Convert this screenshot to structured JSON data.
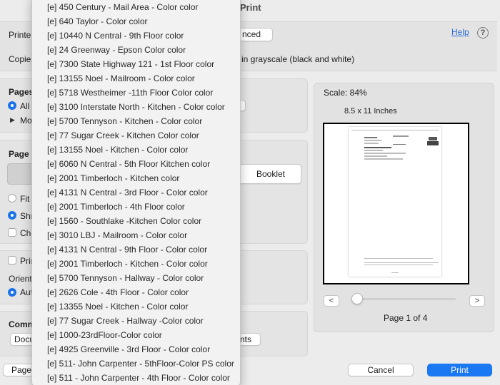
{
  "window": {
    "title": "Print"
  },
  "top": {
    "printer_label": "Printer",
    "advanced_label": "nced",
    "copies_label": "Copies",
    "grayscale_text": "in grayscale (black and white)",
    "help_label": "Help",
    "help_icon": "question-icon"
  },
  "pages": {
    "label": "Pages",
    "all_label": "All",
    "more_label": "Mo"
  },
  "page_scaling": {
    "label": "Page S",
    "booklet_label": "Booklet",
    "fit_label": "Fit",
    "shrink_label": "Shr",
    "choose_label": "Cho"
  },
  "orientation": {
    "print_label": "Prin",
    "orient_label": "Orient",
    "auto_label": "Aut"
  },
  "comments": {
    "label": "Comm",
    "doc_label": "Docu",
    "nts_label": "nts"
  },
  "preview": {
    "scale_text": "Scale:  84%",
    "paper_size": "8.5 x 11 Inches",
    "page_indicator": "Page 1 of 4",
    "prev_icon": "chevron-left-icon",
    "next_icon": "chevron-right-icon"
  },
  "bottom": {
    "page_setup_label": "Page",
    "cancel_label": "Cancel",
    "print_label": "Print",
    "print_color": "#1a78f2"
  },
  "printer_menu": {
    "items": [
      "[e] 450 Century - Mail Area - Color color",
      "[e] 640 Taylor - Color color",
      "[e] 10440 N Central - 9th Floor color",
      "[e] 24 Greenway - Epson Color color",
      "[e] 7300 State Highway 121 - 1st Floor color",
      "[e] 13155 Noel - Mailroom - Color color",
      "[e] 5718 Westheimer -11th Floor Color color",
      "[e] 3100 Interstate North - Kitchen - Color color",
      "[e] 5700 Tennyson - Kitchen - Color color",
      "[e] 77 Sugar Creek - Kitchen Color color",
      "[e] 13155 Noel - Kitchen - Color color",
      "[e] 6060 N Central - 5th Floor Kitchen color",
      "[e] 2001 Timberloch - Kitchen color",
      "[e] 4131 N Central - 3rd Floor - Color color",
      "[e] 2001 Timberloch - 4th Floor color",
      "[e] 1560 - Southlake -Kitchen Color color",
      "[e] 3010 LBJ - Mailroom - Color color",
      "[e] 4131 N Central - 9th Floor - Color color",
      "[e] 2001 Timberloch - Kitchen - Color color",
      "[e] 5700 Tennyson - Hallway - Color color",
      "[e] 2626 Cole - 4th Floor - Color color",
      "[e] 13355 Noel - Kitchen - Color color",
      "[e] 77 Sugar Creek - Hallway -Color color",
      "[e] 1000-23rdFloor-Color color",
      "[e] 4925 Greenville - 3rd Floor - Color color",
      "[e] 511- John Carpenter - 5thFloor-Color PS color",
      "[e] 511 - John Carpenter - 4th Floor - Color color"
    ]
  }
}
